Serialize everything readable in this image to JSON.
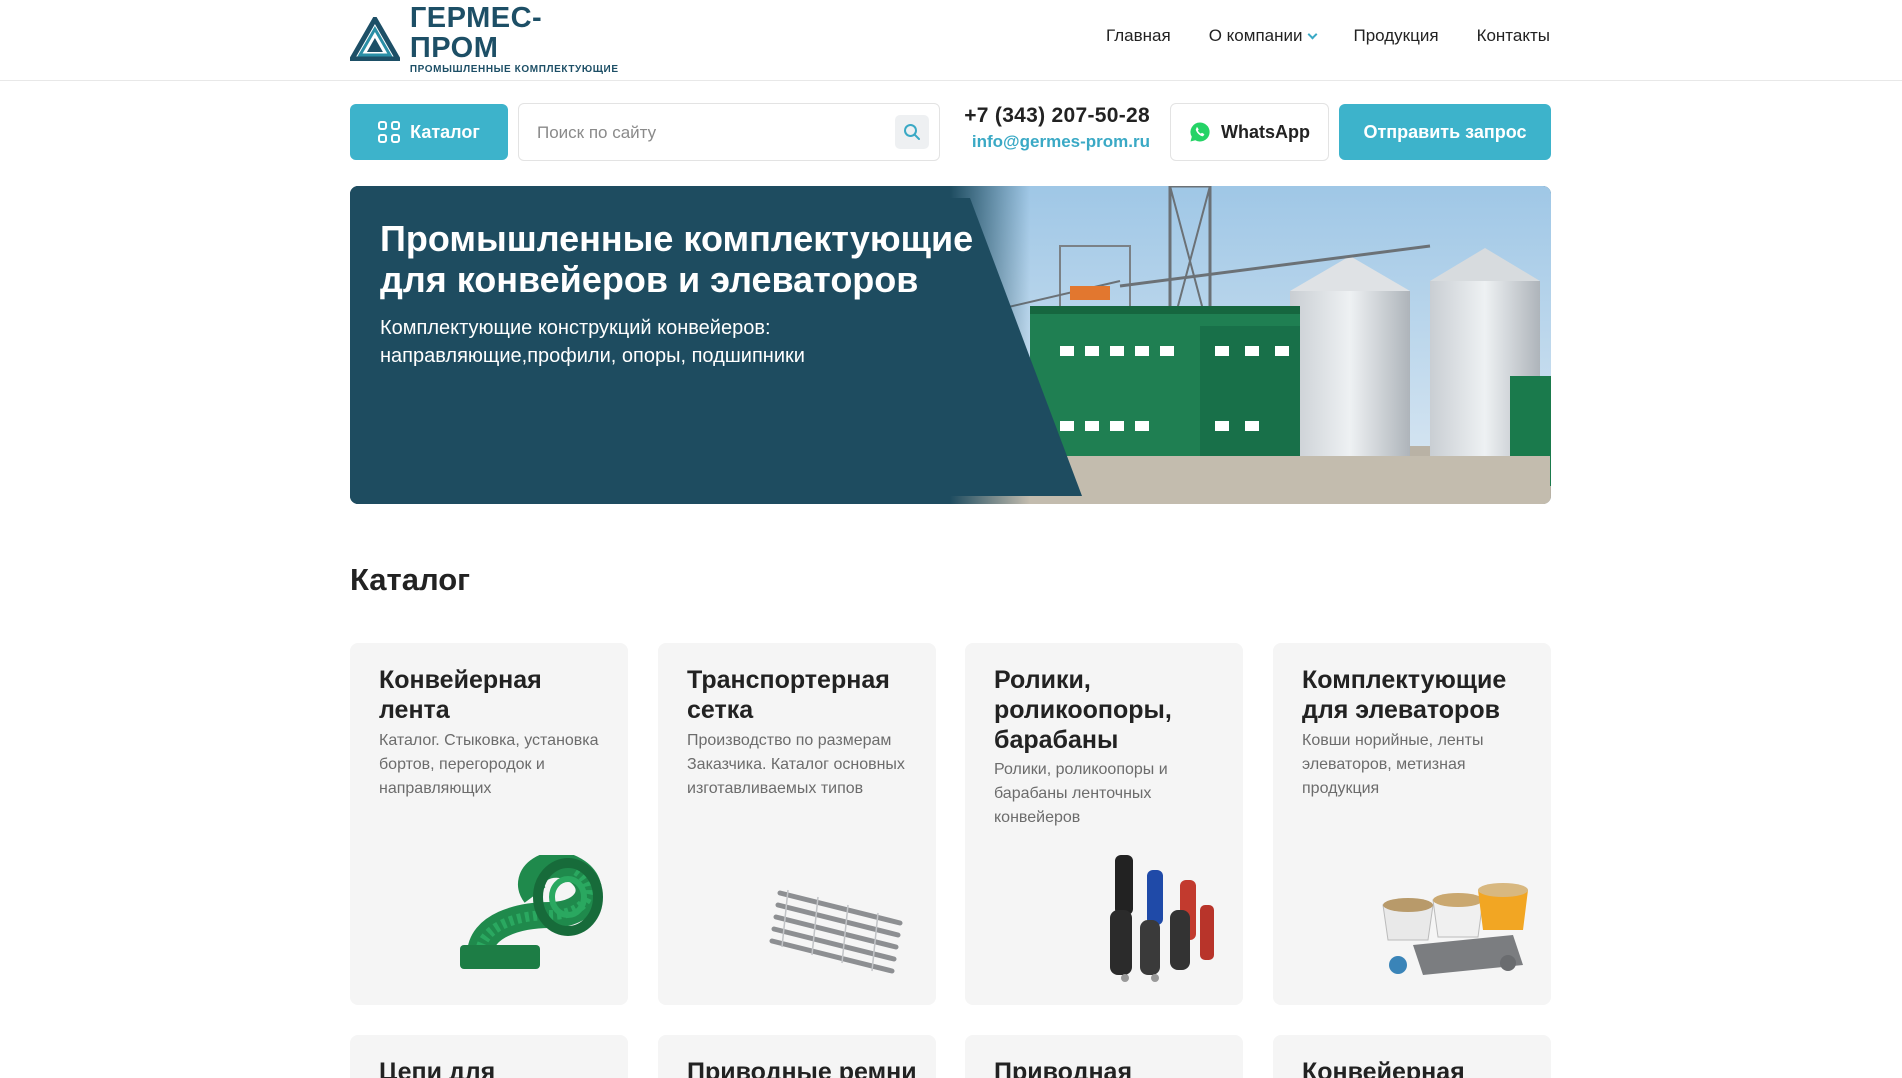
{
  "header": {
    "logo_title": "ГЕРМЕС-ПРОМ",
    "logo_subtitle": "ПРОМЫШЛЕННЫЕ КОМПЛЕКТУЮЩИЕ",
    "nav": [
      {
        "label": "Главная"
      },
      {
        "label": "О компании",
        "has_dropdown": true
      },
      {
        "label": "Продукция"
      },
      {
        "label": "Контакты"
      }
    ]
  },
  "toolbar": {
    "catalog_label": "Каталог",
    "search_placeholder": "Поиск по сайту",
    "phone": "+7 (343) 207-50-28",
    "email": "info@germes-prom.ru",
    "whatsapp_label": "WhatsApp",
    "send_label": "Отправить запрос"
  },
  "hero": {
    "title": "Промышленные комплектующие для конвейеров и элеваторов",
    "subtitle": "Комплектующие конструкций конвейеров: направляющие,профили, опоры, подшипники"
  },
  "catalog": {
    "title": "Каталог",
    "cards": [
      {
        "title": "Конвейерная лента",
        "desc": "Каталог. Стыковка, установка бортов, перегородок и направляющих"
      },
      {
        "title": "Транспортерная сетка",
        "desc": "Производство по размерам Заказчика. Каталог основных изготавливаемых типов"
      },
      {
        "title": "Ролики, роликоопоры, барабаны",
        "desc": "Ролики, роликоопоры и барабаны ленточных конвейеров"
      },
      {
        "title": "Комплектующие для элеваторов",
        "desc": "Ковши норийные, ленты элеваторов, метизная продукция"
      }
    ],
    "cards_row2": [
      {
        "title": "Цепи для"
      },
      {
        "title": "Приводные ремни"
      },
      {
        "title": "Приводная"
      },
      {
        "title": "Конвейерная"
      }
    ]
  },
  "colors": {
    "accent": "#3db3cb",
    "brand_dark": "#1d4f66",
    "hero_bg": "#1e4c60"
  }
}
